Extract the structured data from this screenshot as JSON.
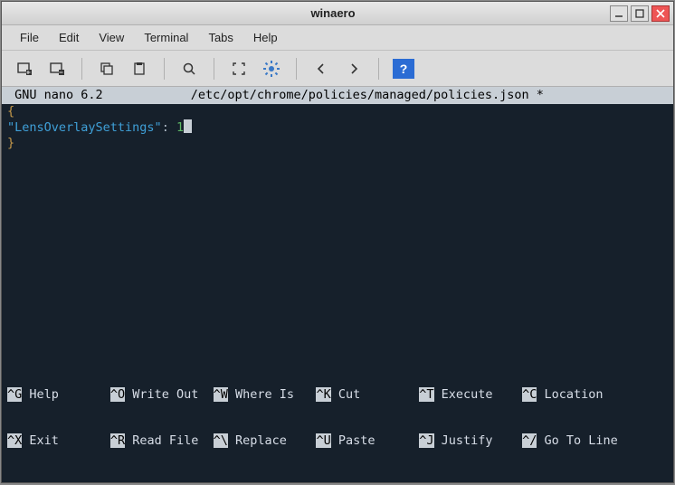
{
  "window": {
    "title": "winaero"
  },
  "menubar": [
    "File",
    "Edit",
    "View",
    "Terminal",
    "Tabs",
    "Help"
  ],
  "toolbar": {
    "icons": [
      "new-tab",
      "close-tab",
      "copy",
      "paste",
      "search",
      "fullscreen",
      "settings",
      "back",
      "forward",
      "help"
    ],
    "help_label": "?"
  },
  "nano": {
    "header_left": " GNU nano 6.2",
    "header_file": "/etc/opt/chrome/policies/managed/policies.json *",
    "open_brace": "{",
    "key": "\"LensOverlaySettings\"",
    "colon": ": ",
    "value": "1",
    "close_brace": "}"
  },
  "shortcuts": {
    "row1": [
      {
        "k": "^G",
        "l": "Help"
      },
      {
        "k": "^O",
        "l": "Write Out"
      },
      {
        "k": "^W",
        "l": "Where Is"
      },
      {
        "k": "^K",
        "l": "Cut"
      },
      {
        "k": "^T",
        "l": "Execute"
      },
      {
        "k": "^C",
        "l": "Location"
      }
    ],
    "row2": [
      {
        "k": "^X",
        "l": "Exit"
      },
      {
        "k": "^R",
        "l": "Read File"
      },
      {
        "k": "^\\",
        "l": "Replace"
      },
      {
        "k": "^U",
        "l": "Paste"
      },
      {
        "k": "^J",
        "l": "Justify"
      },
      {
        "k": "^/",
        "l": "Go To Line"
      }
    ]
  }
}
